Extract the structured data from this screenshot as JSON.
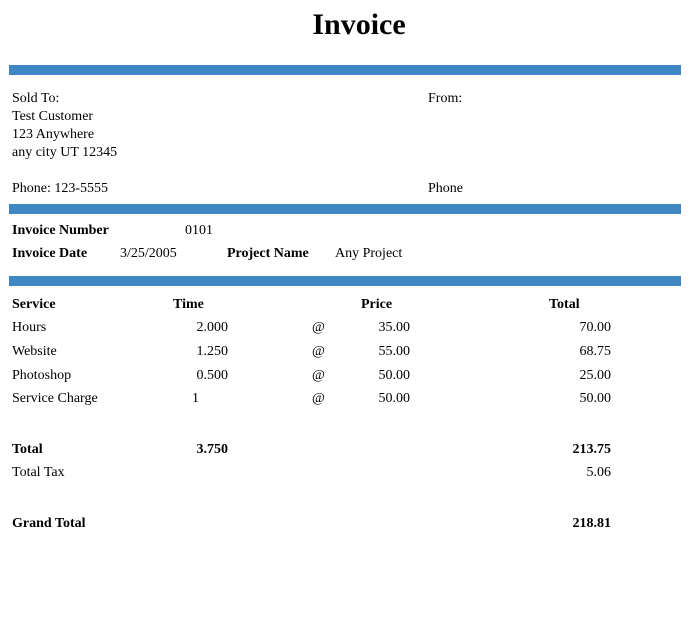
{
  "title": "Invoice",
  "colors": {
    "accent_bar": "#3f86c4"
  },
  "sold_to": {
    "label": "Sold To:",
    "name": "Test Customer",
    "address1": "123 Anywhere",
    "address2": "any city UT 12345",
    "phone": "Phone: 123-5555"
  },
  "from": {
    "label": "From:",
    "phone": "Phone"
  },
  "invoice": {
    "number_label": "Invoice Number",
    "number": "0101",
    "date_label": "Invoice Date",
    "date": "3/25/2005",
    "project_label": "Project Name",
    "project": "Any Project"
  },
  "table": {
    "headers": {
      "service": "Service",
      "time": "Time",
      "price": "Price",
      "total": "Total"
    },
    "rows": [
      {
        "service": "Hours",
        "time": "2.000",
        "at": "@",
        "price": "35.00",
        "total": "70.00"
      },
      {
        "service": "Website",
        "time": "1.250",
        "at": "@",
        "price": "55.00",
        "total": "68.75"
      },
      {
        "service": "Photoshop",
        "time": "0.500",
        "at": "@",
        "price": "50.00",
        "total": "25.00"
      },
      {
        "service": "Service Charge",
        "time": "1",
        "at": "@",
        "price": "50.00",
        "total": "50.00"
      }
    ]
  },
  "summary": {
    "total_label": "Total",
    "total_time": "3.750",
    "total_amount": "213.75",
    "tax_label": "Total Tax",
    "tax_amount": "5.06",
    "grand_label": "Grand Total",
    "grand_amount": "218.81"
  }
}
